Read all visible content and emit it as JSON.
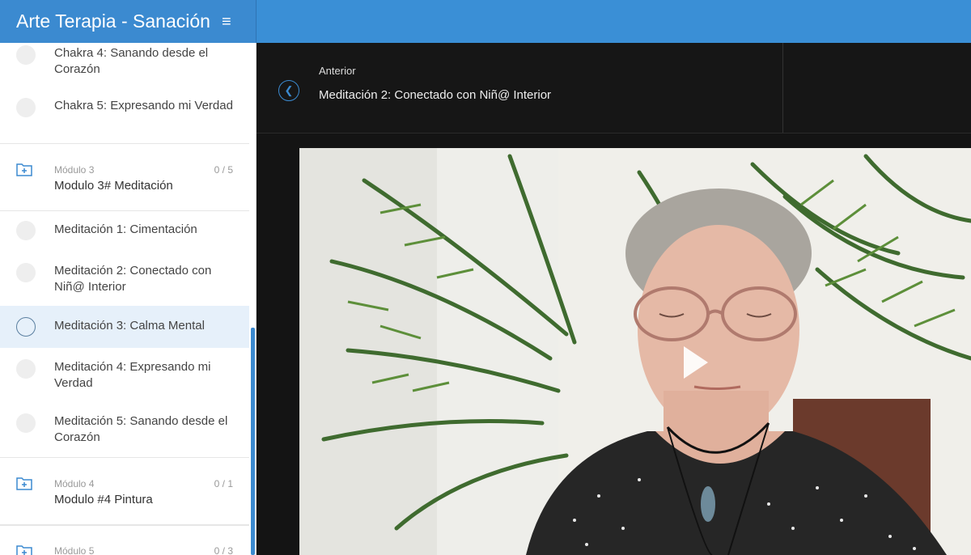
{
  "header": {
    "title": "Arte Terapia - Sanación",
    "menu_icon": "hamburger-icon"
  },
  "sidebar": {
    "lessons_top": [
      {
        "label": "Chakra 4: Sanando desde el Corazón"
      },
      {
        "label": "Chakra 5: Expresando mi Verdad"
      }
    ],
    "module3": {
      "label": "Módulo 3",
      "title": "Modulo 3# Meditación",
      "count": "0 / 5"
    },
    "module3_lessons": [
      {
        "label": "Meditación 1: Cimentación"
      },
      {
        "label": "Meditación 2: Conectado con Niñ@ Interior"
      },
      {
        "label": "Meditación 3: Calma Mental",
        "active": true
      },
      {
        "label": "Meditación 4: Expresando mi Verdad"
      },
      {
        "label": "Meditación 5: Sanando desde el Corazón"
      }
    ],
    "module4": {
      "label": "Módulo 4",
      "title": "Modulo #4 Pintura",
      "count": "0 / 1"
    },
    "module5": {
      "label": "Módulo 5",
      "count": "0 / 3"
    }
  },
  "nav": {
    "prev_label": "Anterior",
    "prev_title": "Meditación 2: Conectado con Niñ@ Interior"
  },
  "colors": {
    "brand": "#3b8ad0",
    "active_row": "#e6f0fa",
    "dark_bg": "#141414"
  }
}
